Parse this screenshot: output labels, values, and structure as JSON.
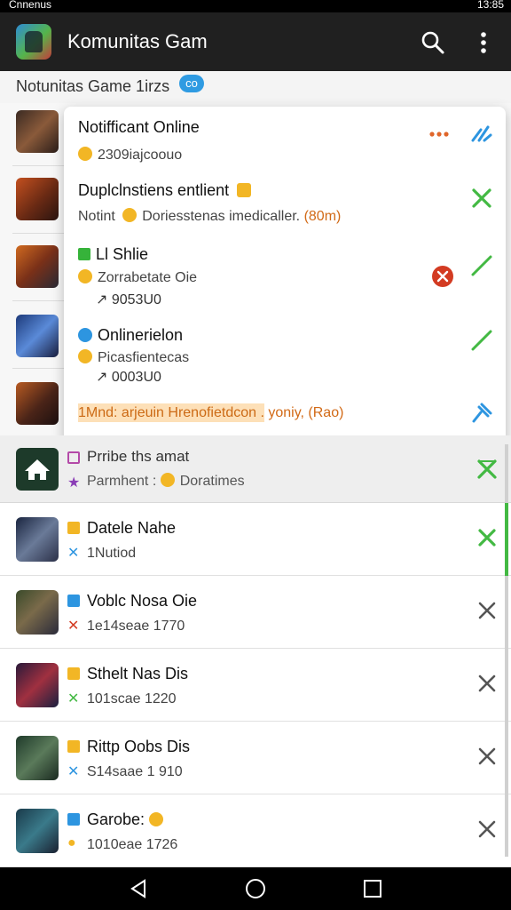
{
  "status_bar": {
    "left_text": "Cnnenus",
    "right_text": "13:85"
  },
  "app_bar": {
    "title": "Komunitas Gam",
    "search_icon": "search-icon",
    "more_icon": "more-vert-icon"
  },
  "subheader": {
    "label": "Notunitas Game 1irzs",
    "badge": "co"
  },
  "popup": {
    "items": [
      {
        "title": "Notifficant Online",
        "sub": "2309iajcoouo"
      },
      {
        "title": "Duplclnstiens entlient",
        "sub_pre": "Notint",
        "sub_mid": "Doriesstenas imedicaller.",
        "sub_orange": "(80m)"
      },
      {
        "title": "Ll Shlie",
        "sub": "Zorrabetate Oie",
        "sub2": "9053U0"
      },
      {
        "title": "Onlinerielon",
        "sub": "Picasfientecas",
        "sub2": "0003U0"
      },
      {
        "highlight": "1Mnd: arjeuin Hrenofietdcon .",
        "tail": "yoniy,",
        "tail_orange": "(Rao)"
      }
    ]
  },
  "pinned": {
    "name": "Prribe ths amat",
    "sub_pre": "Parmhent :",
    "sub_post": "Doratimes"
  },
  "rows": [
    {
      "name": "Datele Nahe",
      "sub": "1Nutiod"
    },
    {
      "name": "Voblc Nosa Oie",
      "sub": "1e14seae 1770"
    },
    {
      "name": "Sthelt Nas Dis",
      "sub": "101scae 1220"
    },
    {
      "name": "Rittp Oobs Dis",
      "sub": "S14saae 1 910"
    },
    {
      "name": "Garobe:",
      "sub": "1010eae 1726"
    }
  ],
  "colors": {
    "accent_green": "#43b943",
    "toolbar": "#202020",
    "accent_blue": "#2d95e0",
    "accent_orange": "#e0662a"
  }
}
